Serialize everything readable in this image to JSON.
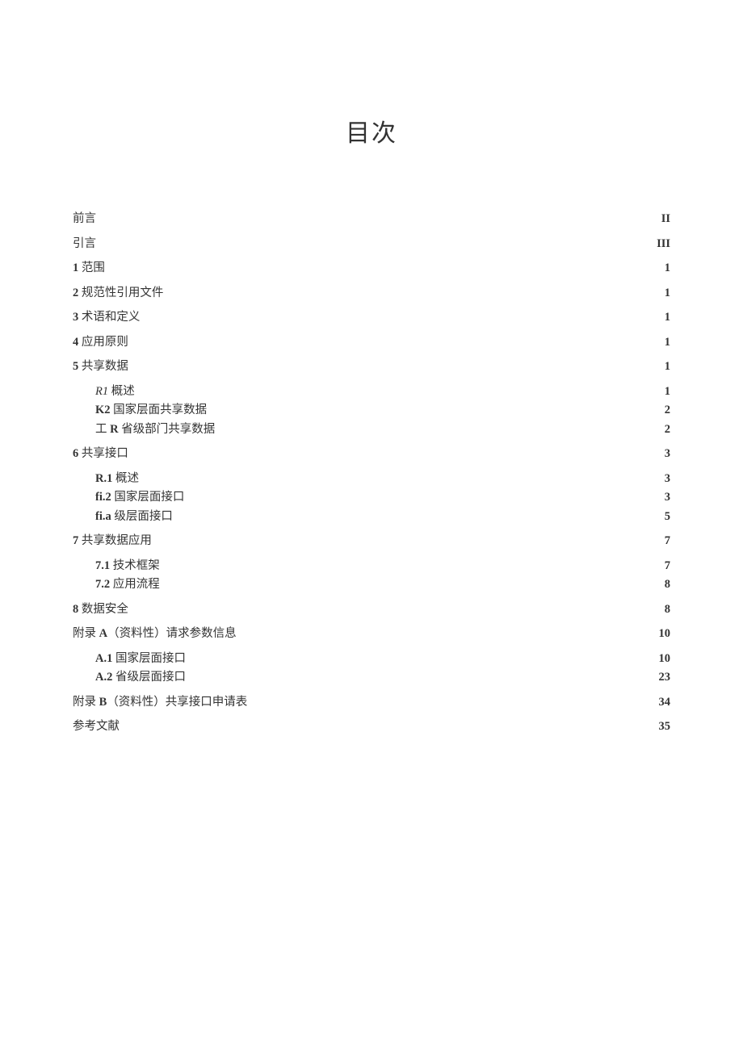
{
  "title": "目次",
  "entries": [
    {
      "level": 0,
      "num": "",
      "text": "前言",
      "page": "II",
      "numBold": false
    },
    {
      "level": 0,
      "num": "",
      "text": "引言",
      "page": "III",
      "numBold": false
    },
    {
      "level": 0,
      "num": "1",
      "text": " 范围",
      "page": "1",
      "numBold": true
    },
    {
      "level": 0,
      "num": "2",
      "text": " 规范性引用文件",
      "page": "1",
      "numBold": true
    },
    {
      "level": 0,
      "num": "3",
      "text": " 术语和定义",
      "page": "1",
      "numBold": true
    },
    {
      "level": 0,
      "num": "4",
      "text": " 应用原则",
      "page": "1",
      "numBold": true
    },
    {
      "level": 0,
      "num": "5",
      "text": " 共享数据",
      "page": "1",
      "numBold": true
    },
    {
      "level": 1,
      "num": "R1",
      "text": " 概述",
      "page": "1",
      "numBold": false,
      "italic": true
    },
    {
      "level": 1,
      "num": "K2",
      "text": " 国家层面共享数据",
      "page": "2",
      "numBold": true
    },
    {
      "level": 1,
      "num": "工 R",
      "text": " 省级部门共享数据",
      "page": "2",
      "numBold": false,
      "midBold": "R"
    },
    {
      "level": 0,
      "num": "6",
      "text": " 共享接口",
      "page": "3",
      "numBold": true,
      "spacer": true
    },
    {
      "level": 1,
      "num": "R.1",
      "text": " 概述",
      "page": "3",
      "numBold": true
    },
    {
      "level": 1,
      "num": "fi.2",
      "text": " 国家层面接口",
      "page": "3",
      "numBold": true
    },
    {
      "level": 1,
      "num": "fi.a",
      "text": " 级层面接口",
      "page": "5",
      "numBold": true
    },
    {
      "level": 0,
      "num": "7",
      "text": " 共享数据应用",
      "page": "7",
      "numBold": true,
      "spacer": true
    },
    {
      "level": 1,
      "num": "7.1",
      "text": " 技术框架",
      "page": "7",
      "numBold": true
    },
    {
      "level": 1,
      "num": "7.2",
      "text": " 应用流程",
      "page": "8",
      "numBold": true
    },
    {
      "level": 0,
      "num": "8",
      "text": " 数据安全",
      "page": "8",
      "numBold": true,
      "spacer": true
    },
    {
      "level": 0,
      "num": "附录 A",
      "text": "（资料性）请求参数信息",
      "page": "10",
      "numBold": false,
      "boldPart": "A"
    },
    {
      "level": 1,
      "num": "A.1",
      "text": " 国家层面接口",
      "page": "10",
      "numBold": true
    },
    {
      "level": 1,
      "num": "A.2",
      "text": " 省级层面接口",
      "page": "23",
      "numBold": true
    },
    {
      "level": 0,
      "num": "附录 B",
      "text": "（资料性）共享接口申请表",
      "page": "34",
      "numBold": false,
      "boldPart": "B",
      "spacer": true
    },
    {
      "level": 0,
      "num": "",
      "text": "参考文献",
      "page": "35",
      "numBold": false
    }
  ]
}
